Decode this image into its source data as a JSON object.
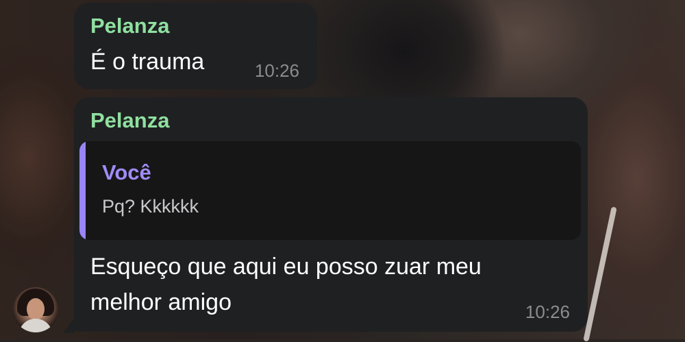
{
  "messages": [
    {
      "sender": "Pelanza",
      "text": "É o trauma",
      "time": "10:26"
    },
    {
      "sender": "Pelanza",
      "reply": {
        "sender": "Você",
        "text": "Pq? Kkkkkk"
      },
      "text_line1": "Esqueço que aqui eu posso zuar meu",
      "text_line2": "melhor amigo",
      "time": "10:26"
    }
  ],
  "colors": {
    "bubble": "#1f2022",
    "sender_name": "#8fe0a0",
    "reply_accent": "#9b85f5",
    "timestamp": "#8c8c90"
  }
}
